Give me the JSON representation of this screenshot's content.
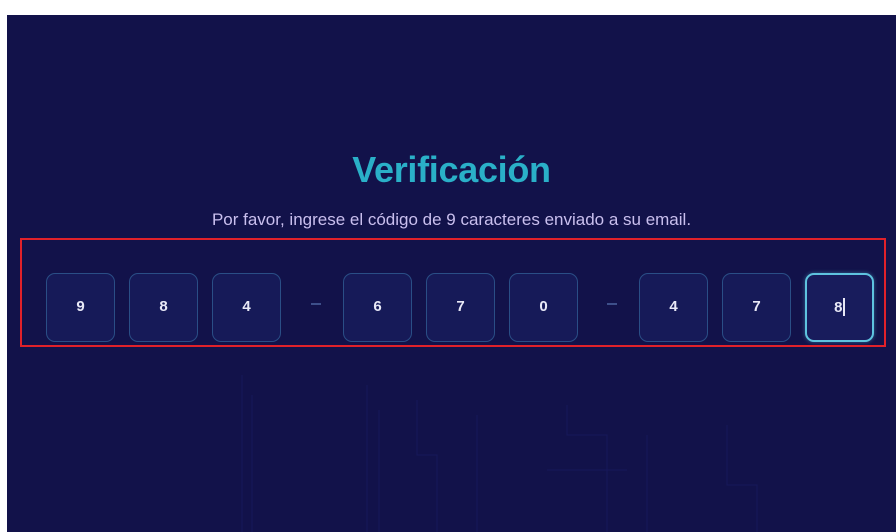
{
  "verification": {
    "title": "Verificación",
    "subtitle": "Por favor, ingrese el código de 9 caracteres enviado a su email.",
    "code": {
      "group1": [
        "9",
        "8",
        "4"
      ],
      "group2": [
        "6",
        "7",
        "0"
      ],
      "group3": [
        "4",
        "7",
        "8"
      ],
      "active_index": 8
    }
  },
  "colors": {
    "background": "#12124a",
    "title": "#2ab0c8",
    "subtitle": "#c9bfee",
    "cell_border": "#2a4e86",
    "active_cell_border": "#5ec3df",
    "highlight": "#e0212a"
  }
}
